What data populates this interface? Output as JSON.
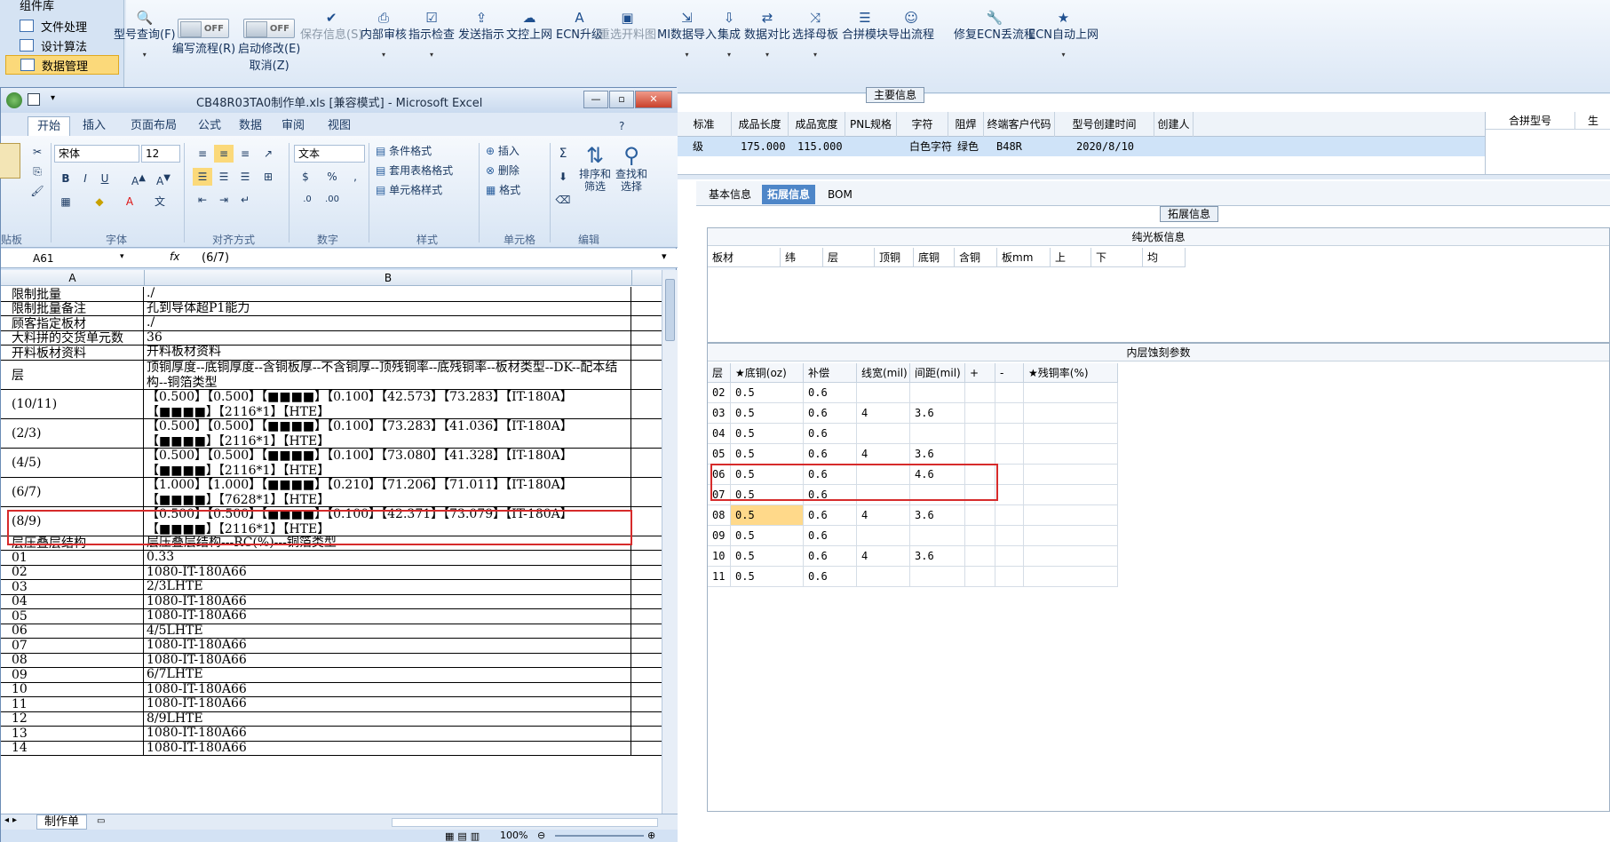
{
  "host": {
    "sidebar": [
      {
        "label": "组件库"
      },
      {
        "label": "文件处理"
      },
      {
        "label": "设计算法"
      },
      {
        "label": "数据管理"
      }
    ],
    "ribbon": [
      {
        "label": "型号查询(F)",
        "icon": "search-icon",
        "arrow": true
      },
      {
        "label": "编写流程(R)",
        "icon": "toggle-off",
        "toggle": "OFF"
      },
      {
        "label": "启动修改(E)",
        "sub": "取消(Z)",
        "icon": "toggle-off",
        "toggle": "OFF"
      },
      {
        "label": "保存信息(S)",
        "icon": "check-icon",
        "disabled": true
      },
      {
        "label": "内部审核",
        "icon": "print-icon",
        "arrow": true
      },
      {
        "label": "指示检查",
        "icon": "check-box-icon",
        "arrow": true
      },
      {
        "label": "发送指示",
        "icon": "upload-icon"
      },
      {
        "label": "文控上网",
        "icon": "cloud-upload-icon"
      },
      {
        "label": "ECN升级",
        "icon": "font-a-icon"
      },
      {
        "label": "重选开料图",
        "icon": "image-icon",
        "disabled": true
      },
      {
        "label": "MI数据导入",
        "icon": "import-icon",
        "arrow": true
      },
      {
        "label": "集成",
        "icon": "download-icon",
        "arrow": true
      },
      {
        "label": "数据对比",
        "icon": "compare-icon",
        "arrow": true
      },
      {
        "label": "选择母板",
        "icon": "shuffle-icon",
        "arrow": true
      },
      {
        "label": "合拼模块",
        "icon": "list-icon"
      },
      {
        "label": "导出流程",
        "icon": "smile-icon"
      },
      {
        "label": "修复ECN丢流程",
        "icon": "wrench-icon"
      },
      {
        "label": "ECN自动上网",
        "icon": "star-icon",
        "arrow": true
      }
    ],
    "main_info": {
      "title": "主要信息",
      "headers": [
        "标准",
        "成品长度",
        "成品宽度",
        "PNL规格",
        "字符",
        "阻焊",
        "终端客户代码",
        "型号创建时间",
        "创建人"
      ],
      "row": [
        "级",
        "175.000",
        "115.000",
        "",
        "白色字符",
        "绿色",
        "B48R",
        "2020/8/10",
        ""
      ],
      "right_headers": [
        "合拼型号",
        "生"
      ]
    },
    "tabs": [
      "基本信息",
      "拓展信息",
      "BOM"
    ],
    "ext_title": "拓展信息",
    "bare_board": {
      "title": "纯光板信息",
      "headers": [
        "板材",
        "纬",
        "层",
        "顶铜",
        "底铜",
        "含铜",
        "板mm",
        "上",
        "下",
        "均"
      ]
    },
    "inner_etch": {
      "title": "内层蚀刻参数",
      "headers": [
        "层",
        "★底铜(oz)",
        "补偿",
        "线宽(mil)",
        "间距(mil)",
        "+",
        "-",
        "★残铜率(%)"
      ],
      "rows": [
        [
          "02",
          "0.5",
          "0.6",
          "",
          ""
        ],
        [
          "03",
          "0.5",
          "0.6",
          "4",
          "3.6"
        ],
        [
          "04",
          "0.5",
          "0.6",
          "",
          ""
        ],
        [
          "05",
          "0.5",
          "0.6",
          "4",
          "3.6"
        ],
        [
          "06",
          "0.5",
          "0.6",
          "",
          "4.6"
        ],
        [
          "07",
          "0.5",
          "0.6",
          "",
          ""
        ],
        [
          "08",
          "0.5",
          "0.6",
          "4",
          "3.6"
        ],
        [
          "09",
          "0.5",
          "0.6",
          "",
          ""
        ],
        [
          "10",
          "0.5",
          "0.6",
          "4",
          "3.6"
        ],
        [
          "11",
          "0.5",
          "0.6",
          "",
          ""
        ]
      ]
    }
  },
  "excel": {
    "title": "CB48R03TA0制作单.xls  [兼容模式] - Microsoft Excel",
    "tabs": [
      "开始",
      "插入",
      "页面布局",
      "公式",
      "数据",
      "审阅",
      "视图"
    ],
    "font_name": "宋体",
    "font_size": "12",
    "number_format": "文本",
    "styles": [
      "条件格式",
      "套用表格格式",
      "单元格样式"
    ],
    "cells_group": [
      "插入",
      "删除",
      "格式"
    ],
    "edit_group": [
      "排序和筛选",
      "查找和选择"
    ],
    "group_labels": [
      "贴板",
      "字体",
      "对齐方式",
      "数字",
      "样式",
      "单元格",
      "编辑"
    ],
    "name_box": "A61",
    "formula": "(6/7)",
    "col_a": "A",
    "col_b": "B",
    "rows": [
      {
        "a": "限制批量",
        "b": "./"
      },
      {
        "a": "限制批量备注",
        "b": "孔到导体超P1能力"
      },
      {
        "a": "顾客指定板材",
        "b": "./"
      },
      {
        "a": "大料拼的交货单元数",
        "b": "36"
      },
      {
        "a": "开料板材资料",
        "b": "开料板材资料"
      },
      {
        "a": "层",
        "b": "顶铜厚度--底铜厚度--含铜板厚--不含铜厚--顶残铜率--底残铜率--板材类型--DK--配本结构--铜箔类型",
        "tall": true
      },
      {
        "a": "(10/11)",
        "b": "【0.500】【0.500】【■■■■】【0.100】【42.573】【73.283】【IT-180A】【■■■■】【2116*1】【HTE】",
        "tall": true
      },
      {
        "a": "(2/3)",
        "b": "【0.500】【0.500】【■■■■】【0.100】【73.283】【41.036】【IT-180A】【■■■■】【2116*1】【HTE】",
        "tall": true
      },
      {
        "a": "(4/5)",
        "b": "【0.500】【0.500】【■■■■】【0.100】【73.080】【41.328】【IT-180A】【■■■■】【2116*1】【HTE】",
        "tall": true
      },
      {
        "a": "(6/7)",
        "b": "【1.000】【1.000】【■■■■】【0.210】【71.206】【71.011】【IT-180A】【■■■■】【7628*1】【HTE】",
        "tall": true
      },
      {
        "a": "(8/9)",
        "b": "【0.500】【0.500】【■■■■】【0.100】【42.371】【73.079】【IT-180A】【■■■■】【2116*1】【HTE】",
        "tall": true
      },
      {
        "a": "层压叠层结构",
        "b": "层压叠层结构---RC(%)---铜箔类型"
      },
      {
        "a": "01",
        "b": "0.33"
      },
      {
        "a": "02",
        "b": "1080-IT-180A66"
      },
      {
        "a": "03",
        "b": "2/3LHTE"
      },
      {
        "a": "04",
        "b": "1080-IT-180A66"
      },
      {
        "a": "05",
        "b": "1080-IT-180A66"
      },
      {
        "a": "06",
        "b": "4/5LHTE"
      },
      {
        "a": "07",
        "b": "1080-IT-180A66"
      },
      {
        "a": "08",
        "b": "1080-IT-180A66"
      },
      {
        "a": "09",
        "b": "6/7LHTE"
      },
      {
        "a": "10",
        "b": "1080-IT-180A66"
      },
      {
        "a": "11",
        "b": "1080-IT-180A66"
      },
      {
        "a": "12",
        "b": "8/9LHTE"
      },
      {
        "a": "13",
        "b": "1080-IT-180A66"
      },
      {
        "a": "14",
        "b": "1080-IT-180A66"
      }
    ],
    "sheet_tab": "制作单",
    "zoom": "100%"
  }
}
